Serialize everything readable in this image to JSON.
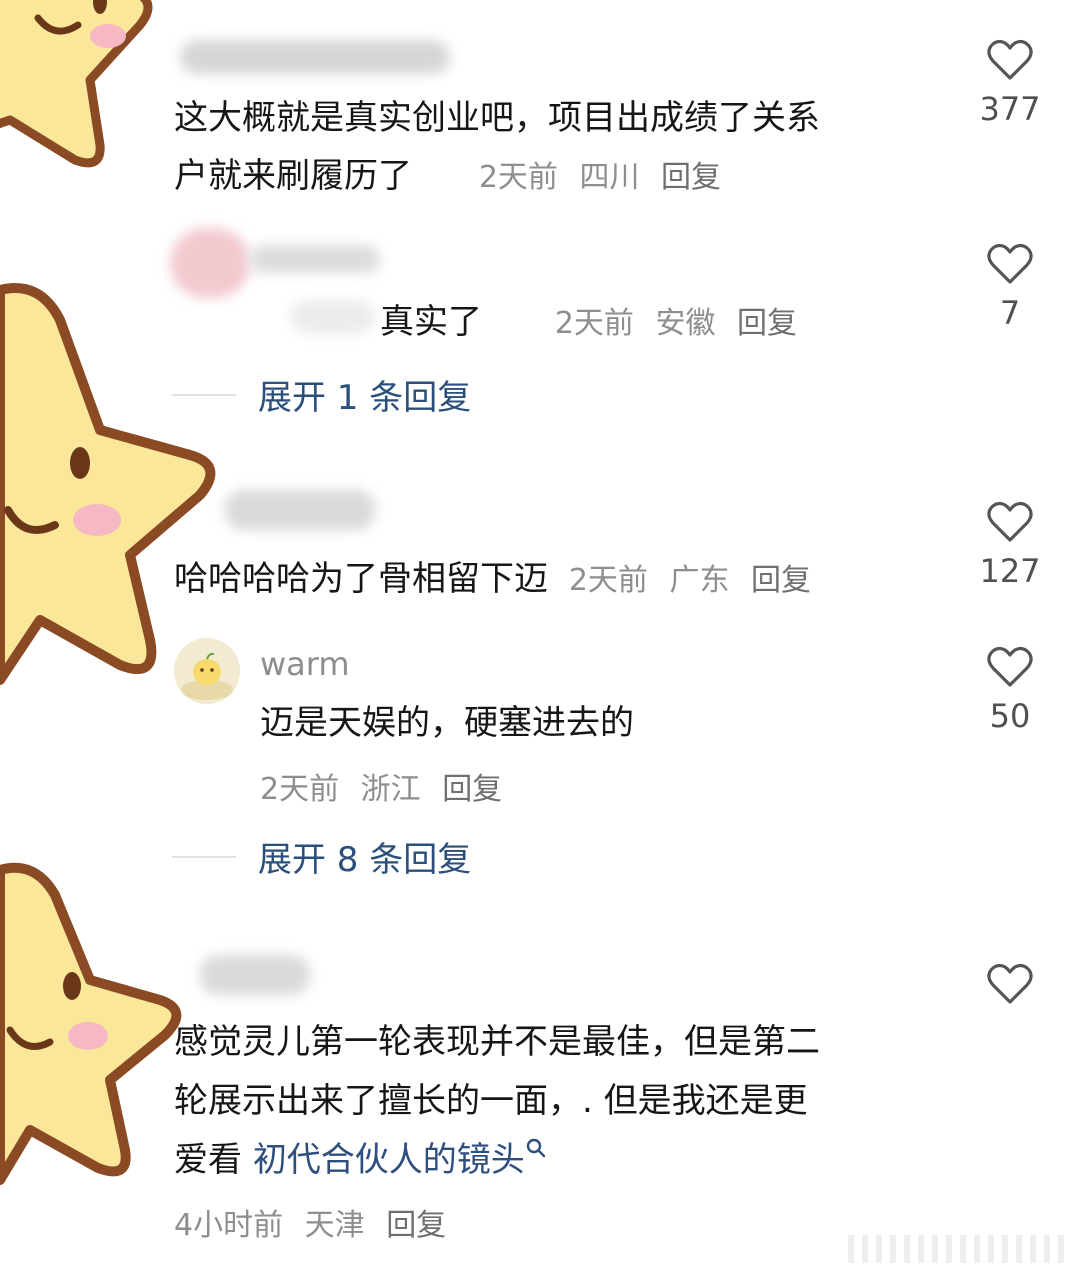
{
  "comments": [
    {
      "text_line1": "这大概就是真实创业吧，项目出成绩了关系",
      "text_line2": "户就来刷履历了",
      "time": "2天前",
      "location": "四川",
      "reply": "回复",
      "likes": "377"
    },
    {
      "text": "真实了",
      "time": "2天前",
      "location": "安徽",
      "reply": "回复",
      "likes": "7",
      "expand": "展开 1 条回复"
    },
    {
      "text": "哈哈哈哈为了骨相留下迈",
      "time": "2天前",
      "location": "广东",
      "reply": "回复",
      "likes": "127",
      "sub_reply": {
        "username": "warm",
        "text": "迈是天娱的，硬塞进去的",
        "time": "2天前",
        "location": "浙江",
        "reply": "回复",
        "likes": "50"
      },
      "expand": "展开 8 条回复"
    },
    {
      "text_line1": "感觉灵儿第一轮表现并不是最佳，但是第二",
      "text_line2": "轮展示出来了擅长的一面，. 但是我还是更",
      "text_line3_prefix": "爱看 ",
      "text_line3_link": "初代合伙人的镜头",
      "time": "4小时前",
      "location": "天津",
      "reply": "回复"
    }
  ],
  "icons": {
    "like": "heart-outline-icon",
    "search": "search-icon"
  },
  "colors": {
    "link": "#2d4e7e",
    "meta": "#8e8e8e",
    "star": "#fbe79a",
    "star_outline": "#8a4a24",
    "cheek": "#f6b8c4"
  }
}
